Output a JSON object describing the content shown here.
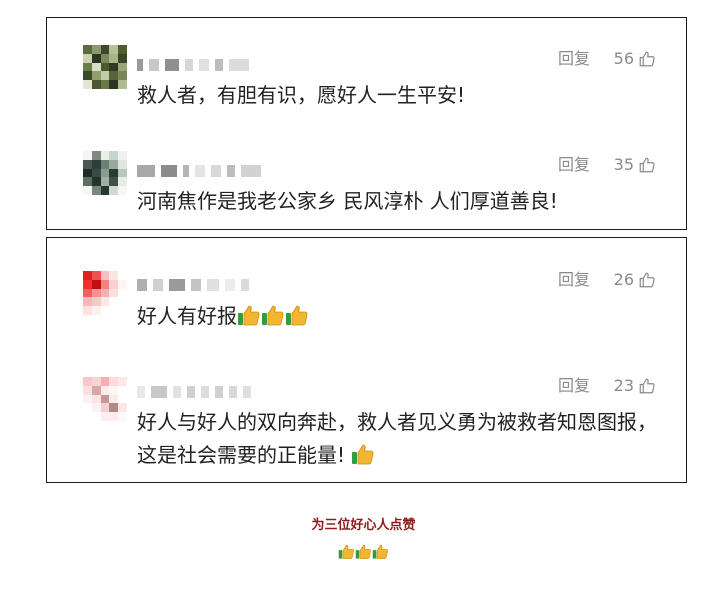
{
  "comments": [
    {
      "reply_label": "回复",
      "likes": "56",
      "text": "救人者，有胆有识，愿好人一生平安!"
    },
    {
      "reply_label": "回复",
      "likes": "35",
      "text": "河南焦作是我老公家乡 民风淳朴 人们厚道善良!"
    },
    {
      "reply_label": "回复",
      "likes": "26",
      "text": "好人有好报"
    },
    {
      "reply_label": "回复",
      "likes": "23",
      "text": "好人与好人的双向奔赴，救人者见义勇为被救者知恩图报，这是社会需要的正能量!"
    }
  ],
  "caption": "为三位好心人点赞",
  "icons": {
    "like": "thumbs-up-outline-icon",
    "emoji": "thumbs-up-emoji-icon"
  },
  "colors": {
    "caption": "#8a1c1c",
    "meta_gray": "#8a8a8a",
    "text": "#222222",
    "emoji_yellow": "#f2b632",
    "emoji_green": "#2e9e3e"
  }
}
